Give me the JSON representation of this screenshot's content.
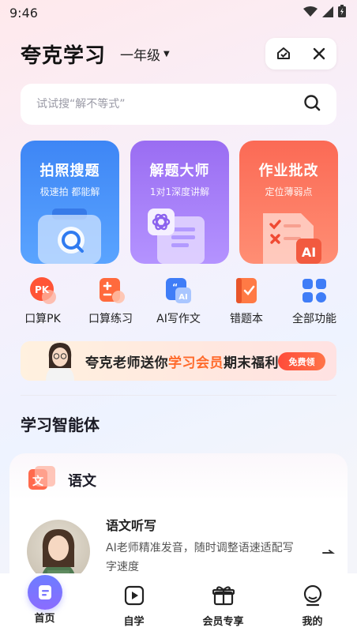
{
  "status_bar": {
    "time": "9:46"
  },
  "header": {
    "app_title": "夸克学习",
    "grade": "一年级"
  },
  "search": {
    "placeholder": "试试搜“解不等式”"
  },
  "cards": [
    {
      "title": "拍照搜题",
      "subtitle": "极速拍 都能解",
      "color": "#3e86f5"
    },
    {
      "title": "解题大师",
      "subtitle": "1对1深度讲解",
      "color": "#9a6df2"
    },
    {
      "title": "作业批改",
      "subtitle": "定位薄弱点",
      "color": "#fb6a55"
    }
  ],
  "features": [
    {
      "label": "口算PK",
      "icon": "pk-icon"
    },
    {
      "label": "口算练习",
      "icon": "calculator-icon"
    },
    {
      "label": "AI写作文",
      "icon": "ai-writing-icon"
    },
    {
      "label": "错题本",
      "icon": "notebook-icon"
    },
    {
      "label": "全部功能",
      "icon": "grid-icon"
    }
  ],
  "banner": {
    "text_before": "夸克老师送你",
    "text_highlight": "学习会员",
    "text_after": "期末福利",
    "button": "免费领"
  },
  "section": {
    "title": "学习智能体"
  },
  "panel": {
    "subject": "语文",
    "lesson_title": "语文听写",
    "lesson_desc": "AI老师精准发音，随时调整语速适配写字速度"
  },
  "tabbar": [
    {
      "label": "首页",
      "active": true
    },
    {
      "label": "自学",
      "active": false
    },
    {
      "label": "会员专享",
      "active": false
    },
    {
      "label": "我的",
      "active": false
    }
  ]
}
